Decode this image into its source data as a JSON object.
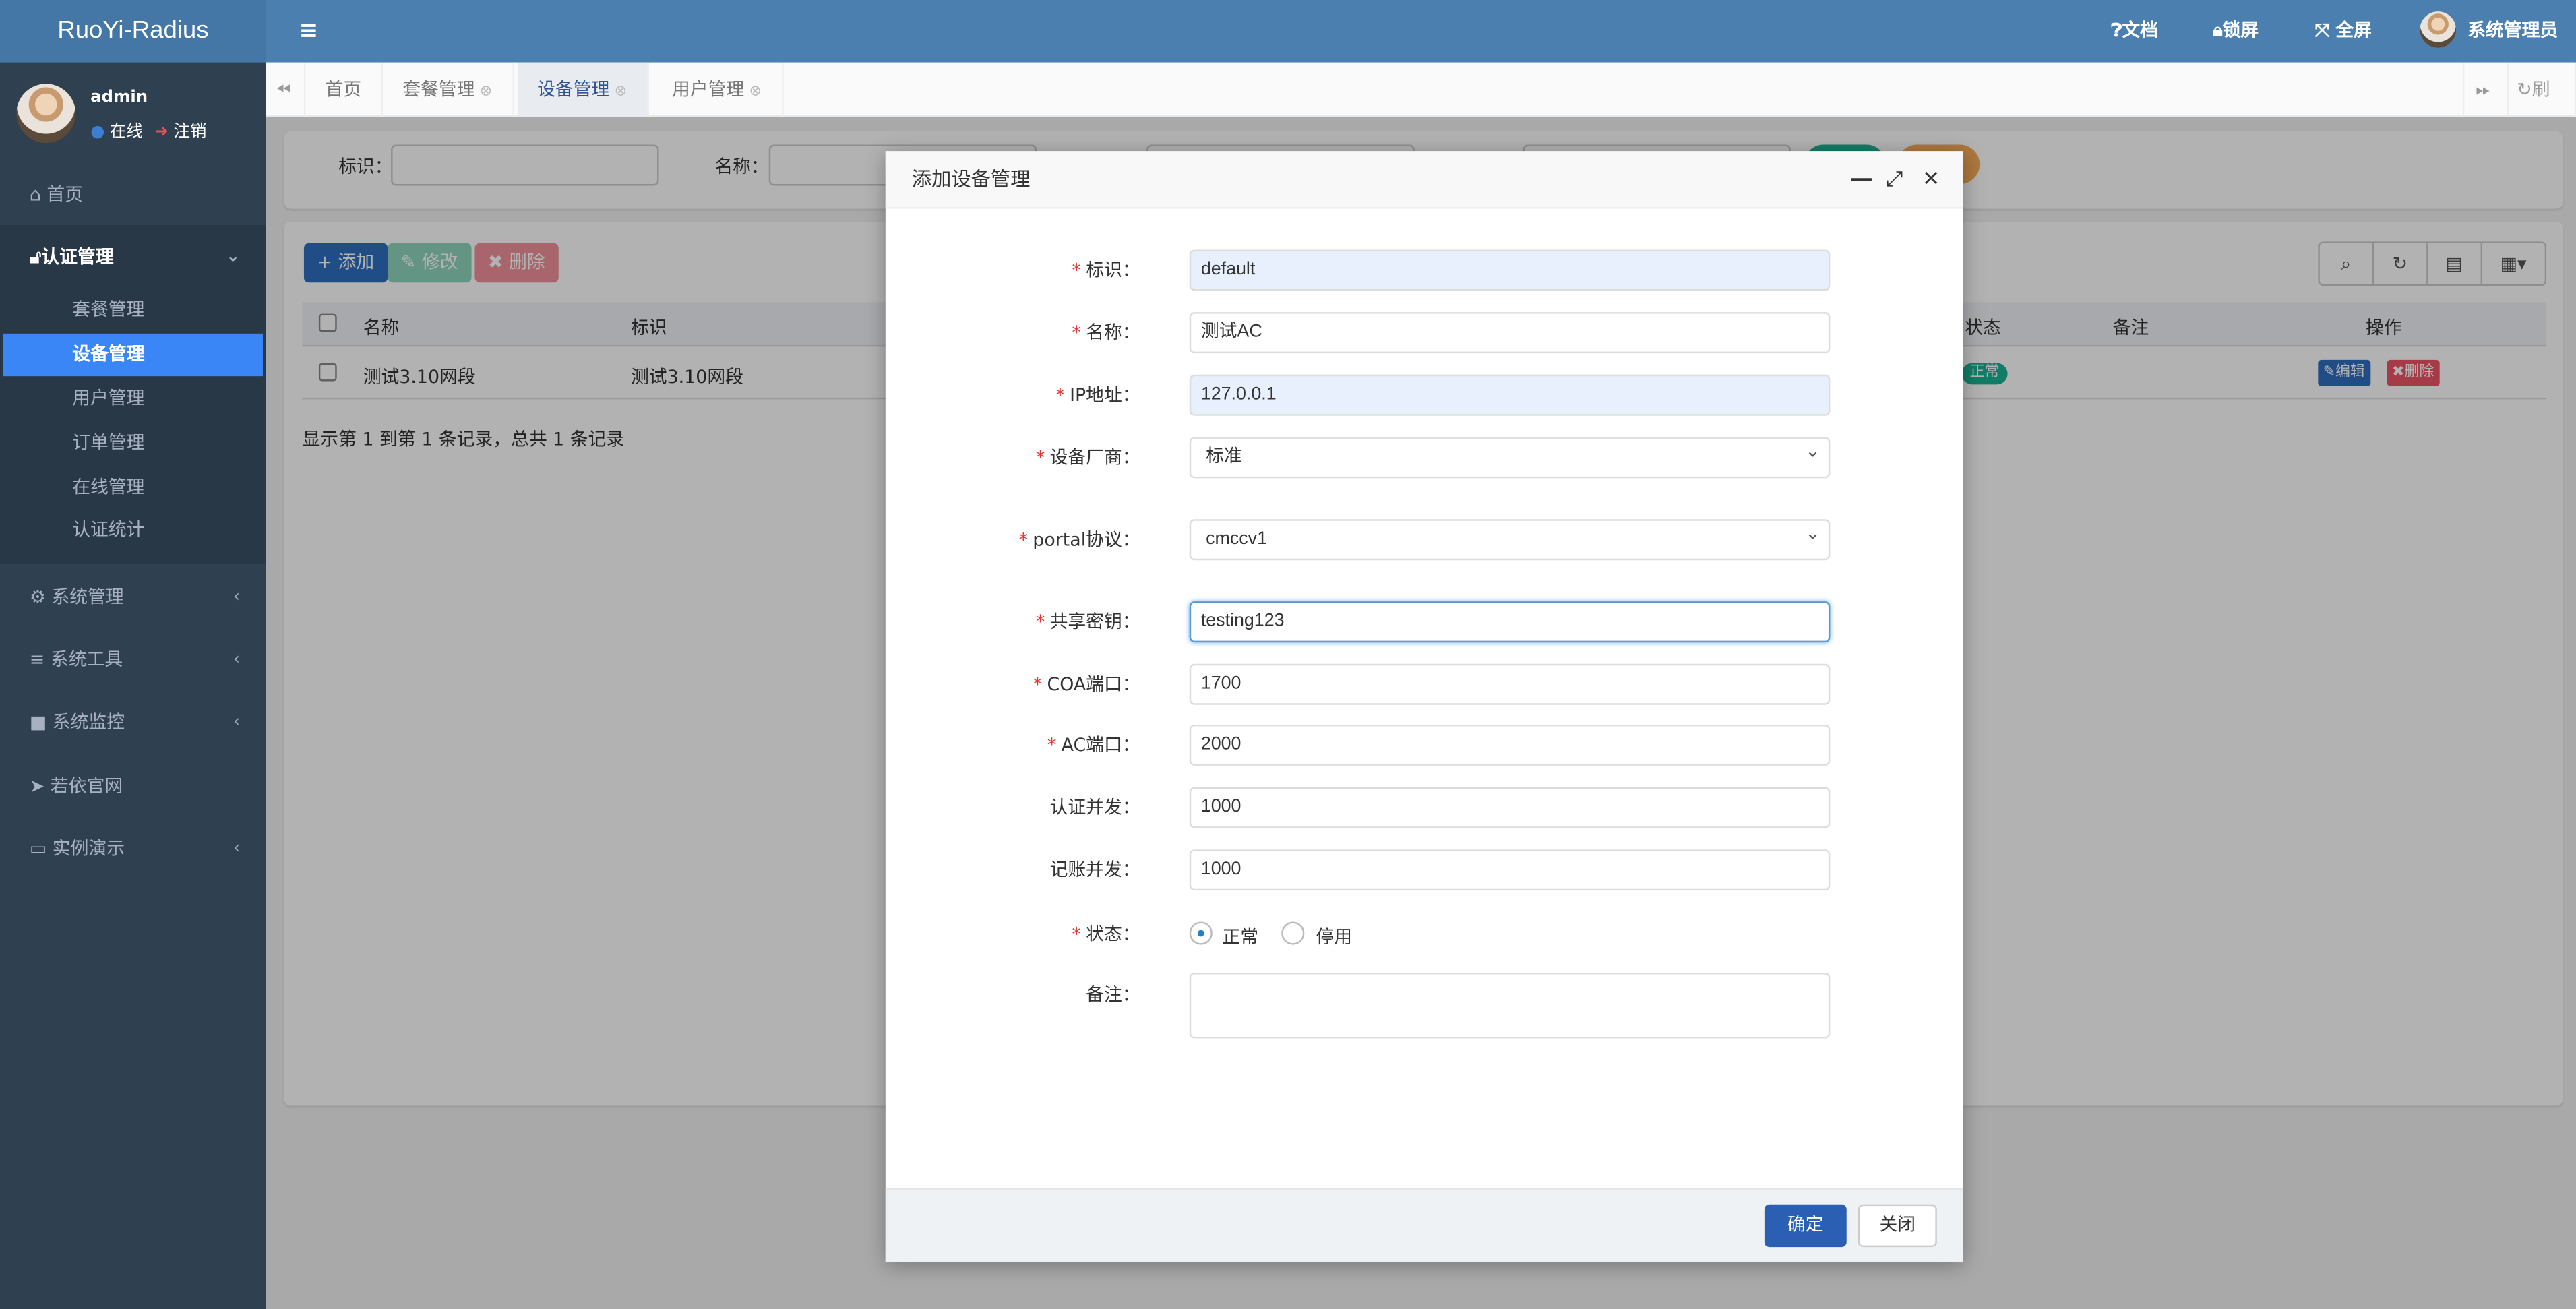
{
  "app": {
    "title": "RuoYi-Radius"
  },
  "user": {
    "name": "admin",
    "status": "在线",
    "logout": "注销"
  },
  "sidebar": {
    "items": [
      {
        "label": "首页",
        "icon": "home-icon"
      },
      {
        "label": "认证管理",
        "icon": "unlock-icon",
        "expanded": true,
        "children": [
          "套餐管理",
          "设备管理",
          "用户管理",
          "订单管理",
          "在线管理",
          "认证统计"
        ],
        "active": "设备管理"
      },
      {
        "label": "系统管理",
        "icon": "gear-icon"
      },
      {
        "label": "系统工具",
        "icon": "bars-icon"
      },
      {
        "label": "系统监控",
        "icon": "video-icon"
      },
      {
        "label": "若依官网",
        "icon": "send-icon"
      },
      {
        "label": "实例演示",
        "icon": "desktop-icon"
      }
    ]
  },
  "topbar": {
    "docs": "文档",
    "lock": "锁屏",
    "fullscreen": "全屏",
    "username": "系统管理员"
  },
  "tabs": {
    "items": [
      "首页",
      "套餐管理",
      "设备管理",
      "用户管理"
    ],
    "active": "设备管理",
    "refresh": "刷新"
  },
  "search": {
    "label1": "标识：",
    "label2": "名称："
  },
  "toolbar": {
    "add": "添加",
    "edit": "修改",
    "delete": "删除"
  },
  "table": {
    "columns": [
      "名称",
      "标识",
      "状态",
      "备注",
      "操作"
    ],
    "rows": [
      {
        "name": "测试3.10网段",
        "id": "测试3.10网段",
        "status": "正常",
        "edit": "编辑",
        "delete": "删除"
      }
    ],
    "footer": "显示第 1 到第 1 条记录，总共 1 条记录"
  },
  "modal": {
    "title": "添加设备管理",
    "fields": [
      {
        "label": "标识：",
        "value": "default",
        "required": true
      },
      {
        "label": "名称：",
        "value": "测试AC",
        "required": true
      },
      {
        "label": "IP地址：",
        "value": "127.0.0.1",
        "required": true
      },
      {
        "label": "设备厂商：",
        "value": "标准",
        "required": true
      },
      {
        "label": "portal协议：",
        "value": "cmccv1",
        "required": true
      },
      {
        "label": "共享密钥：",
        "value": "testing123",
        "required": true
      },
      {
        "label": "COA端口：",
        "value": "1700",
        "required": true
      },
      {
        "label": "AC端口：",
        "value": "2000",
        "required": true
      },
      {
        "label": "认证并发：",
        "value": "1000",
        "required": false
      },
      {
        "label": "记账并发：",
        "value": "1000",
        "required": false
      }
    ],
    "status": {
      "label": "状态：",
      "options": [
        "正常",
        "停用"
      ],
      "selected": "正常"
    },
    "remark": {
      "label": "备注：",
      "value": ""
    },
    "confirm": "确定",
    "close": "关闭"
  },
  "colors": {
    "header": "#4a7fb0",
    "sidebar": "#2f4050",
    "active": "#3b86f7",
    "primary": "#2b5fb4"
  }
}
